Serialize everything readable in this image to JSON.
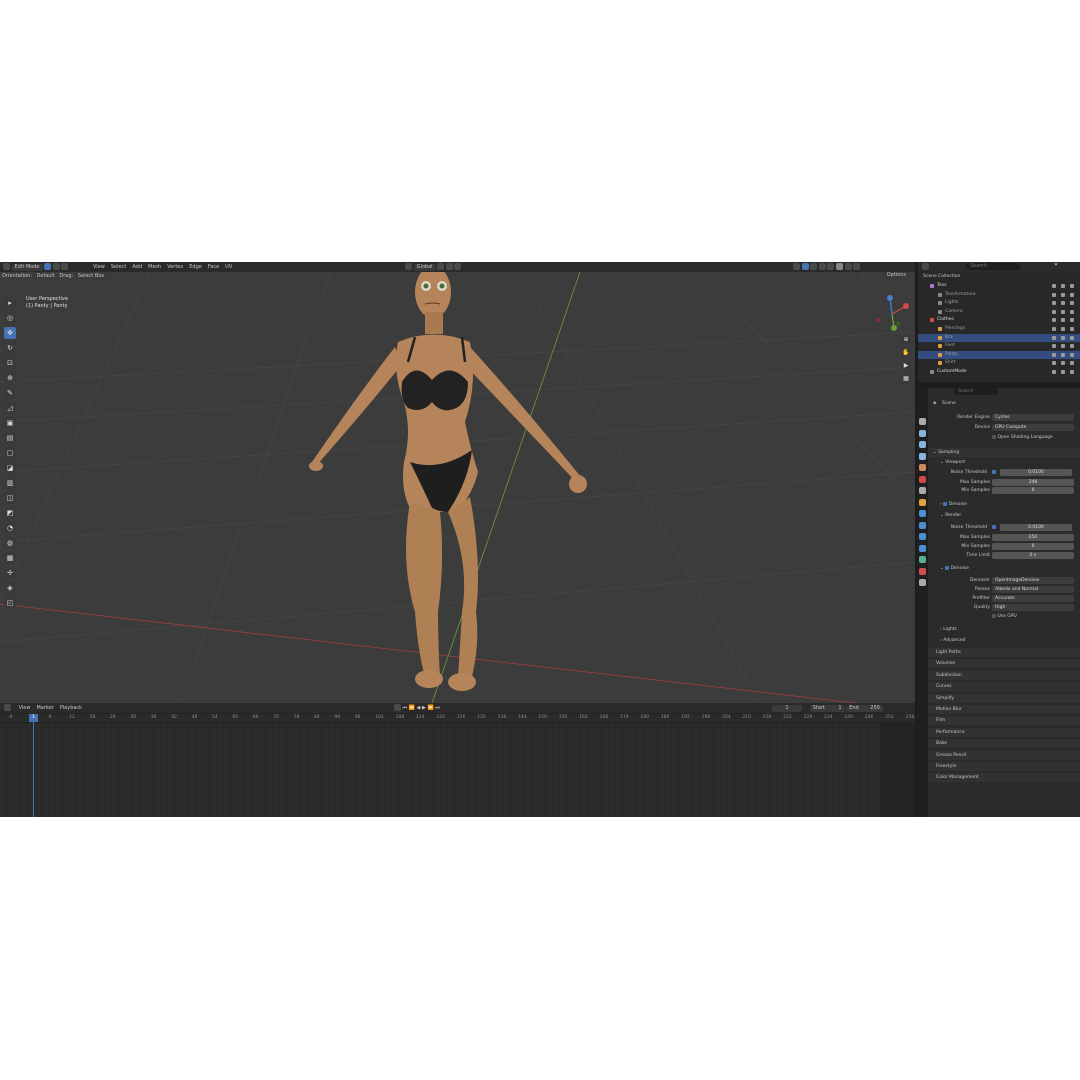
{
  "header": {
    "mode": "Edit Mode",
    "menus": [
      "View",
      "Select",
      "Add",
      "Mesh",
      "Vertex",
      "Edge",
      "Face",
      "UV"
    ],
    "transform": "Global",
    "orientation_label": "Orientation:",
    "orientation_value": "Default",
    "drag_label": "Drag:",
    "drag_value": "Select Box",
    "options": "Options"
  },
  "viewport": {
    "perspective": "User Perspective",
    "object": "(1) Panty | Panty"
  },
  "timeline": {
    "menus": [
      "View",
      "Marker",
      "Playback"
    ],
    "current_frame": "1",
    "start_label": "Start",
    "start": "1",
    "end_label": "End",
    "end": "250",
    "ruler": [
      "-4",
      "1",
      "6",
      "12",
      "18",
      "24",
      "30",
      "36",
      "42",
      "48",
      "54",
      "60",
      "66",
      "72",
      "78",
      "84",
      "90",
      "96",
      "102",
      "108",
      "114",
      "120",
      "126",
      "132",
      "138",
      "144",
      "150",
      "156",
      "162",
      "168",
      "174",
      "180",
      "186",
      "192",
      "198",
      "204",
      "210",
      "216",
      "222",
      "228",
      "234",
      "240",
      "246",
      "252",
      "258"
    ]
  },
  "outliner": {
    "search_placeholder": "Search",
    "root": "Scene Collection",
    "items": [
      {
        "name": "Tess",
        "indent": 0,
        "color": "#a87cd6",
        "selected": false
      },
      {
        "name": "TessArmature",
        "indent": 1,
        "color": "#8a8a8a",
        "selected": false
      },
      {
        "name": "Lights",
        "indent": 1,
        "color": "#8a8a8a",
        "selected": false
      },
      {
        "name": "Camera",
        "indent": 1,
        "color": "#8a8a8a",
        "selected": false
      },
      {
        "name": "Clothes",
        "indent": 0,
        "color": "#d84c4c",
        "selected": false
      },
      {
        "name": "Piercings",
        "indent": 1,
        "color": "#e0a040",
        "selected": false
      },
      {
        "name": "Bra",
        "indent": 1,
        "color": "#e0a040",
        "selected": true
      },
      {
        "name": "Feet",
        "indent": 1,
        "color": "#e0a040",
        "selected": false
      },
      {
        "name": "Panty",
        "indent": 1,
        "color": "#e0a040",
        "selected": true
      },
      {
        "name": "Shirt",
        "indent": 1,
        "color": "#e0a040",
        "selected": false
      },
      {
        "name": "CustomMode",
        "indent": 0,
        "color": "#8a8a8a",
        "selected": false
      }
    ]
  },
  "properties": {
    "search_placeholder": "Search",
    "scene": "Scene",
    "render_engine_label": "Render Engine",
    "render_engine": "Cycles",
    "device_label": "Device",
    "device": "GPU Compute",
    "osl": "Open Shading Language",
    "sampling": "Sampling",
    "viewport": "Viewport",
    "noise_threshold_label": "Noise Threshold",
    "vp_noise": "0.0100",
    "max_samples_label": "Max Samples",
    "vp_max": "248",
    "min_samples_label": "Min Samples",
    "vp_min": "0",
    "denoise": "Denoise",
    "render": "Render",
    "r_noise": "0.0100",
    "r_max": "250",
    "r_min": "0",
    "time_limit_label": "Time Limit",
    "r_time": "0 s",
    "denoiser_label": "Denoiser",
    "denoiser": "OpenImageDenoise",
    "passes_label": "Passes",
    "passes": "Albedo and Normal",
    "prefilter_label": "Prefilter",
    "prefilter": "Accurate",
    "quality_label": "Quality",
    "quality": "High",
    "use_gpu": "Use GPU",
    "lights": "Lights",
    "advanced": "Advanced",
    "panels": [
      "Light Paths",
      "Volumes",
      "Subdivision",
      "Curves",
      "Simplify",
      "Motion Blur",
      "Film",
      "Performance",
      "Bake",
      "Grease Pencil",
      "Freestyle",
      "Color Management"
    ]
  },
  "colors": {
    "accent": "#4772b3",
    "viewport_bg": "#3c3c3c",
    "skin": "#b5845a",
    "x_axis": "#a23c3c",
    "y_axis": "#6e9a3a"
  }
}
